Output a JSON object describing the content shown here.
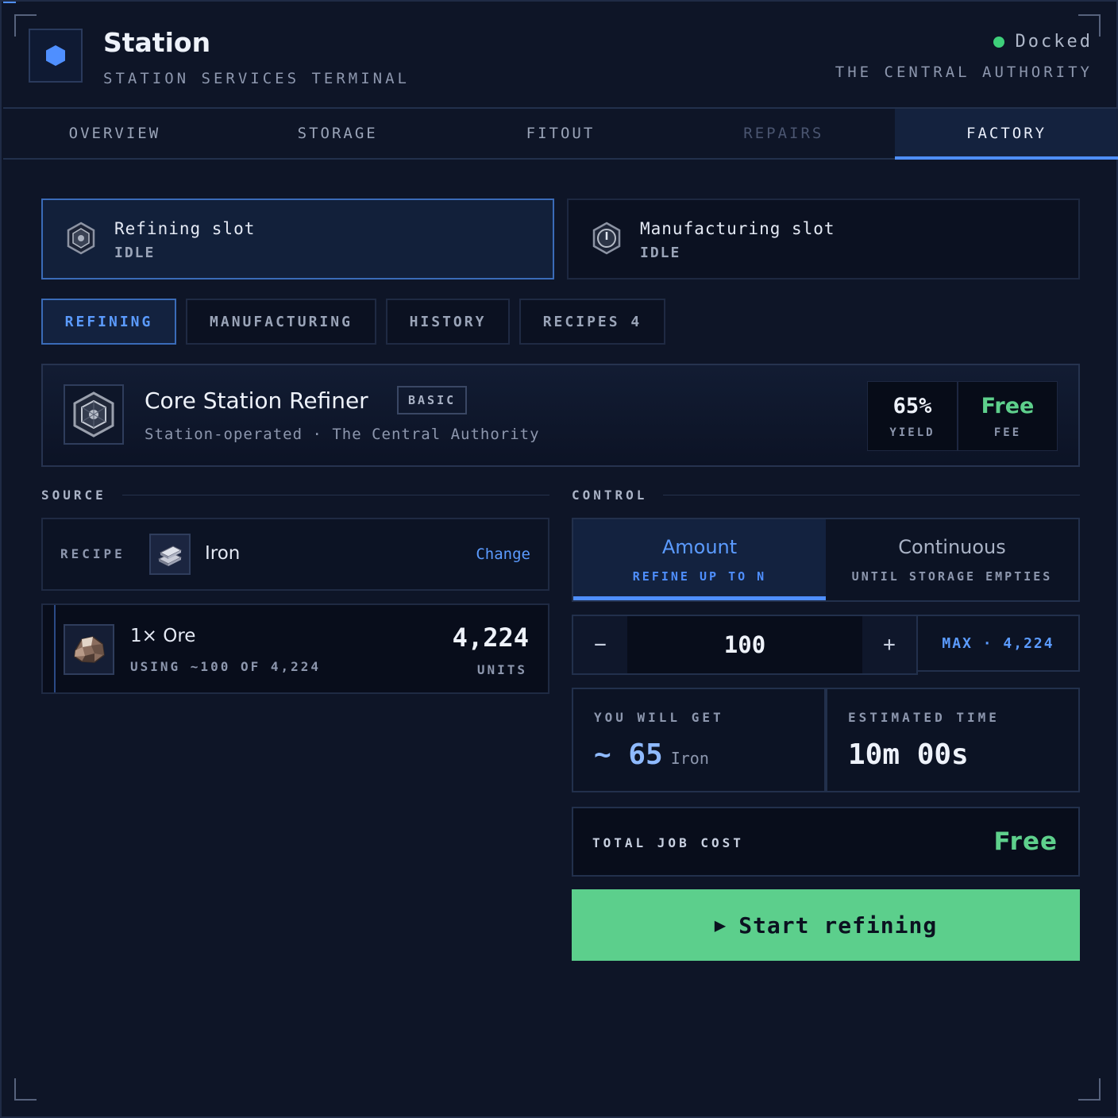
{
  "header": {
    "title": "Station",
    "subtitle": "STATION SERVICES TERMINAL",
    "status": "Docked",
    "authority": "THE CENTRAL AUTHORITY",
    "status_color": "#3ecf7a"
  },
  "tabs": [
    {
      "label": "OVERVIEW",
      "state": "normal"
    },
    {
      "label": "STORAGE",
      "state": "normal"
    },
    {
      "label": "FITOUT",
      "state": "normal"
    },
    {
      "label": "REPAIRS",
      "state": "disabled"
    },
    {
      "label": "FACTORY",
      "state": "active"
    }
  ],
  "slots": [
    {
      "name": "Refining slot",
      "state": "IDLE",
      "active": true,
      "icon": "refinery-icon"
    },
    {
      "name": "Manufacturing slot",
      "state": "IDLE",
      "active": false,
      "icon": "gear-icon"
    }
  ],
  "subtabs": [
    {
      "label": "REFINING",
      "active": true
    },
    {
      "label": "MANUFACTURING",
      "active": false
    },
    {
      "label": "HISTORY",
      "active": false
    },
    {
      "label": "RECIPES 4",
      "active": false
    }
  ],
  "refiner": {
    "name": "Core Station Refiner",
    "badge": "BASIC",
    "subtitle": "Station-operated · The Central Authority",
    "yield_value": "65%",
    "yield_label": "YIELD",
    "fee_value": "Free",
    "fee_label": "FEE"
  },
  "source": {
    "heading": "SOURCE",
    "recipe_label": "RECIPE",
    "recipe_name": "Iron",
    "change_label": "Change",
    "ore_name": "1× Ore",
    "ore_using": "USING ~100 OF 4,224",
    "ore_count": "4,224",
    "ore_units": "UNITS"
  },
  "control": {
    "heading": "CONTROL",
    "modes": [
      {
        "title": "Amount",
        "sub": "REFINE UP TO N",
        "active": true
      },
      {
        "title": "Continuous",
        "sub": "UNTIL STORAGE EMPTIES",
        "active": false
      }
    ],
    "minus": "−",
    "plus": "+",
    "amount": "100",
    "max_label": "MAX · 4,224",
    "get_label": "YOU WILL GET",
    "get_value": "~ 65",
    "get_unit": "Iron",
    "time_label": "ESTIMATED TIME",
    "time_value": "10m 00s",
    "total_label": "TOTAL JOB COST",
    "total_value": "Free",
    "start_icon": "▶",
    "start_label": "Start refining"
  },
  "colors": {
    "accent": "#4f8fff",
    "success": "#5ccf8c",
    "background": "#0e1527"
  }
}
